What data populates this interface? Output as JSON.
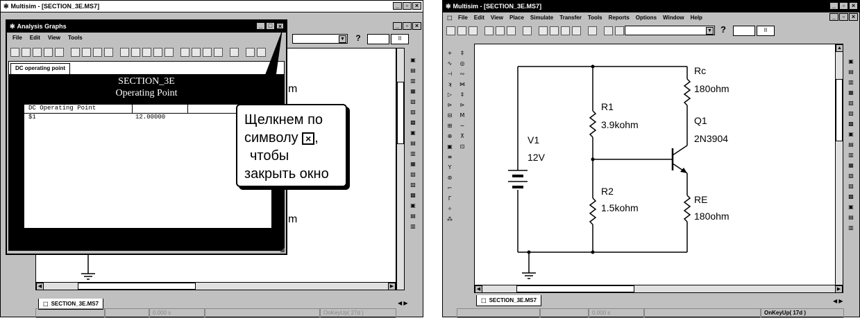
{
  "left": {
    "main_title": "Multisim - [SECTION_3E.MS7]",
    "tab_label": "SECTION_3E.MS7",
    "status_time": "0.000 s",
    "status_key": "OnKeyUp( 27d )",
    "help_symbol": "?",
    "analysis": {
      "title": "Analysis Graphs",
      "menu": [
        "File",
        "Edit",
        "View",
        "Tools"
      ],
      "tab": "DC operating point",
      "heading": "SECTION_3E",
      "subheading": "Operating Point",
      "table_header": "DC Operating Point",
      "row_name": "$1",
      "row_value": "12.00000"
    },
    "callout": {
      "line1": "Щелкнем по",
      "line2": "символу",
      "line2_suffix": ",",
      "x_symbol": "×",
      "line3": "чтобы",
      "line4": "закрыть окно"
    },
    "schematic_m": "m"
  },
  "right": {
    "title": "Multisim - [SECTION_3E.MS7]",
    "menu": [
      "File",
      "Edit",
      "View",
      "Place",
      "Simulate",
      "Transfer",
      "Tools",
      "Reports",
      "Options",
      "Window",
      "Help"
    ],
    "help_symbol": "?",
    "tab_label": "SECTION_3E.MS7",
    "status_time": "0.000 s",
    "status_key": "OnKeyUp( 17d )",
    "components": {
      "v1_name": "V1",
      "v1_value": "12V",
      "r1_name": "R1",
      "r1_value": "3.9kohm",
      "r2_name": "R2",
      "r2_value": "1.5kohm",
      "rc_name": "Rc",
      "rc_value": "180ohm",
      "re_name": "RE",
      "re_value": "180ohm",
      "q1_name": "Q1",
      "q1_value": "2N3904"
    }
  },
  "colors": {
    "titlebar_dark": "#000000",
    "panel": "#c0c0c0",
    "canvas": "#ffffff"
  }
}
